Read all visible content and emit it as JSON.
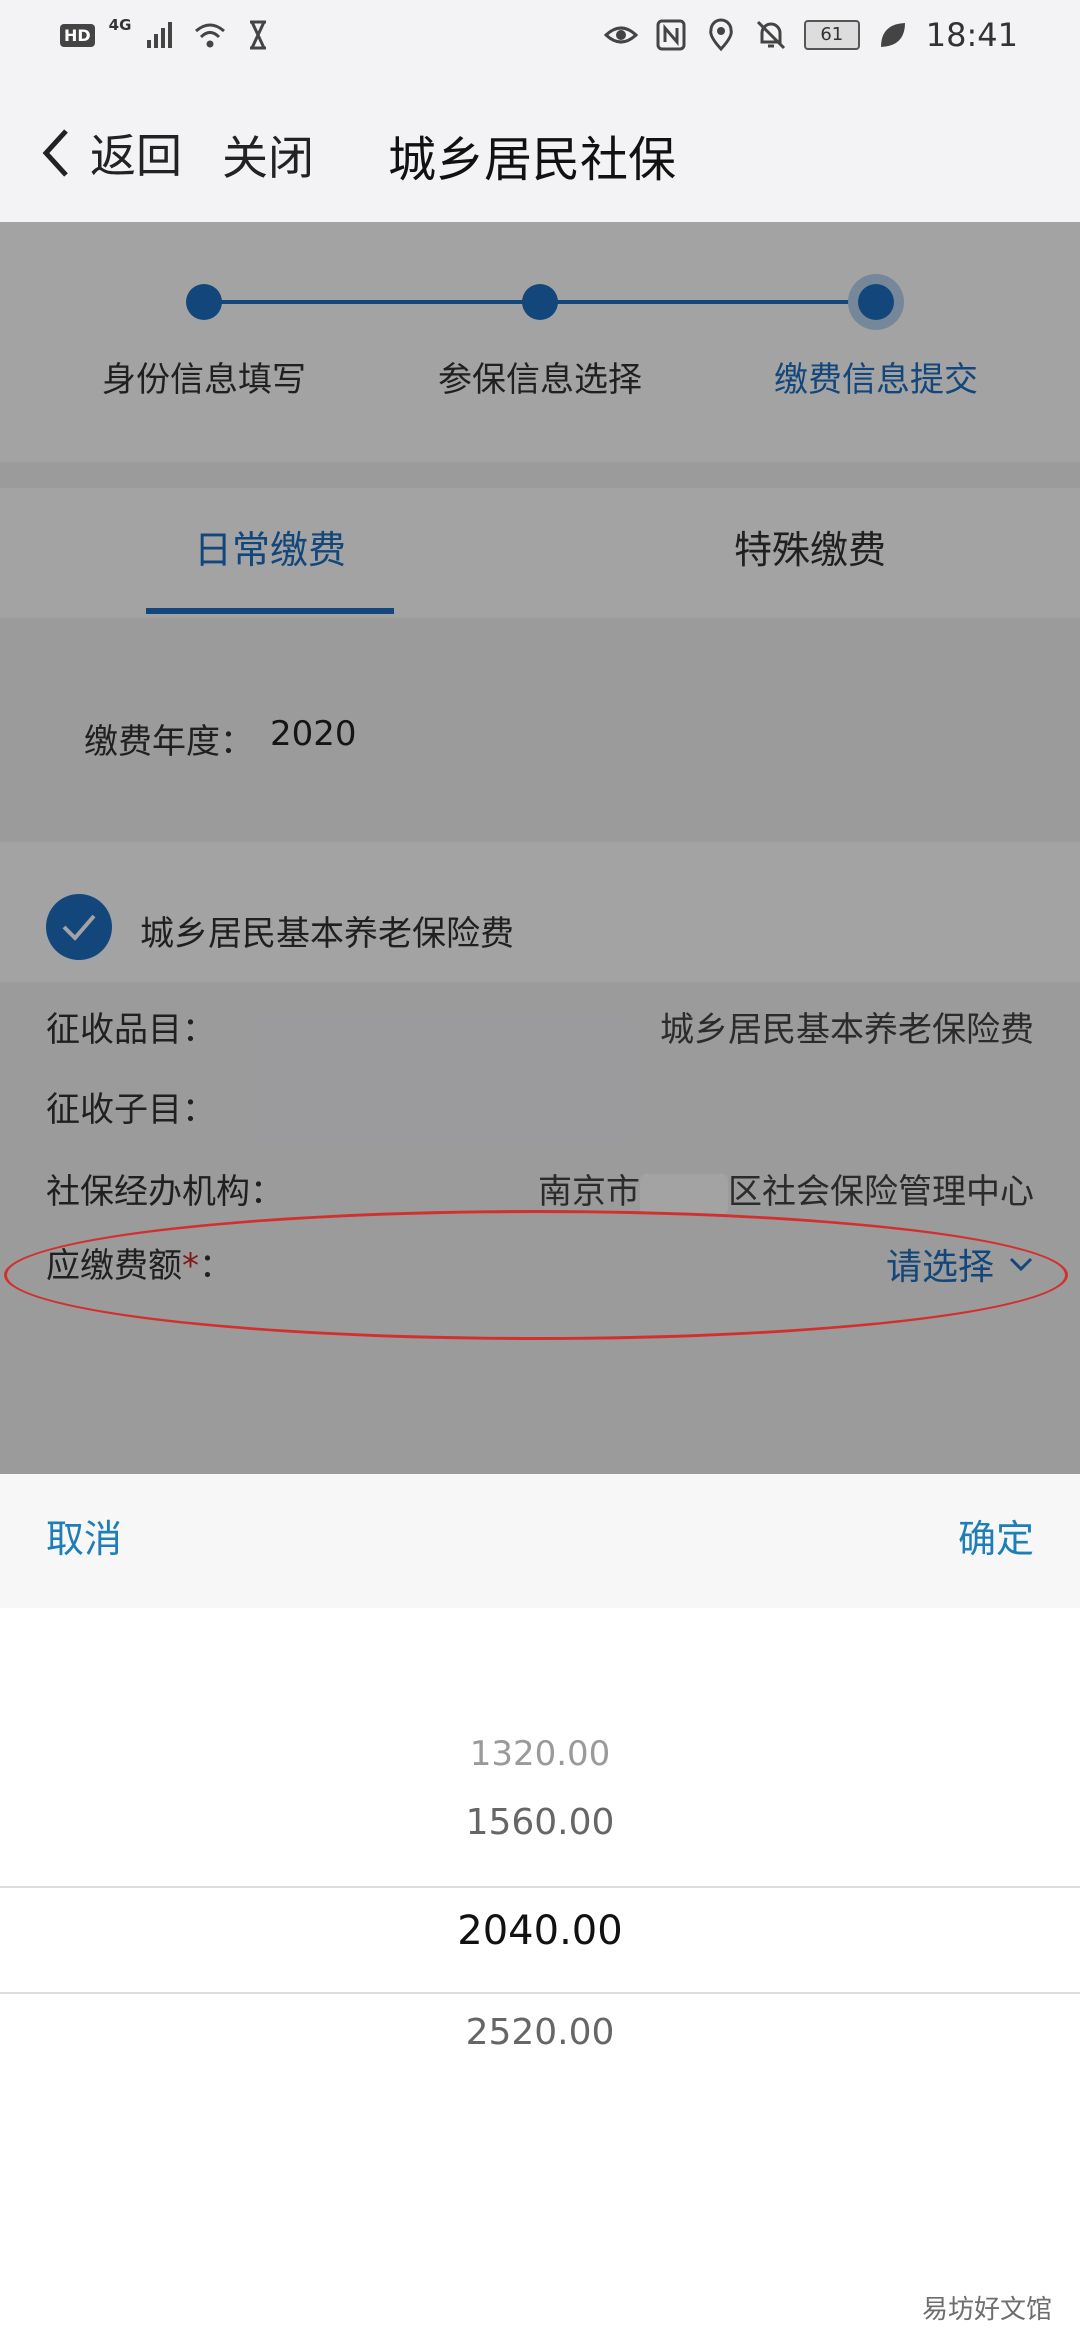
{
  "status_bar": {
    "hd_label": "HD",
    "network_label": "4G",
    "battery": "61",
    "time": "18:41",
    "icons": [
      "signal-icon",
      "wifi-icon",
      "hourglass-icon",
      "eye-icon",
      "nfc-icon",
      "location-icon",
      "mute-icon",
      "leaf-icon"
    ]
  },
  "nav": {
    "back_label": "返回",
    "close_label": "关闭",
    "title": "城乡居民社保"
  },
  "steps": [
    {
      "label": "身份信息填写",
      "active": false
    },
    {
      "label": "参保信息选择",
      "active": false
    },
    {
      "label": "缴费信息提交",
      "active": true
    }
  ],
  "tabs": [
    {
      "label": "日常缴费",
      "active": true
    },
    {
      "label": "特殊缴费",
      "active": false
    }
  ],
  "year": {
    "label": "缴费年度：",
    "value": "2020"
  },
  "insurance": {
    "checked": true,
    "label": "城乡居民基本养老保险费"
  },
  "details": [
    {
      "key": "征收品目：",
      "value": "城乡居民基本养老保险费"
    },
    {
      "key": "征收子目：",
      "value": ""
    },
    {
      "key": "社保经办机构：",
      "value_prefix": "南京市",
      "value_suffix": "区社会保险管理中心"
    }
  ],
  "amount": {
    "label": "应缴费额",
    "star": "*",
    "colon": "：",
    "placeholder": "请选择"
  },
  "picker": {
    "cancel_label": "取消",
    "confirm_label": "确定",
    "options": [
      "1320.00",
      "1560.00",
      "2040.00",
      "2520.00"
    ],
    "selected": "2040.00"
  },
  "watermark": "易坊好文馆",
  "colors": {
    "accent": "#1e6fc0",
    "sheet_action": "#1e7fb8",
    "annotation_red": "#d32f2f",
    "required_star": "#c62828"
  }
}
